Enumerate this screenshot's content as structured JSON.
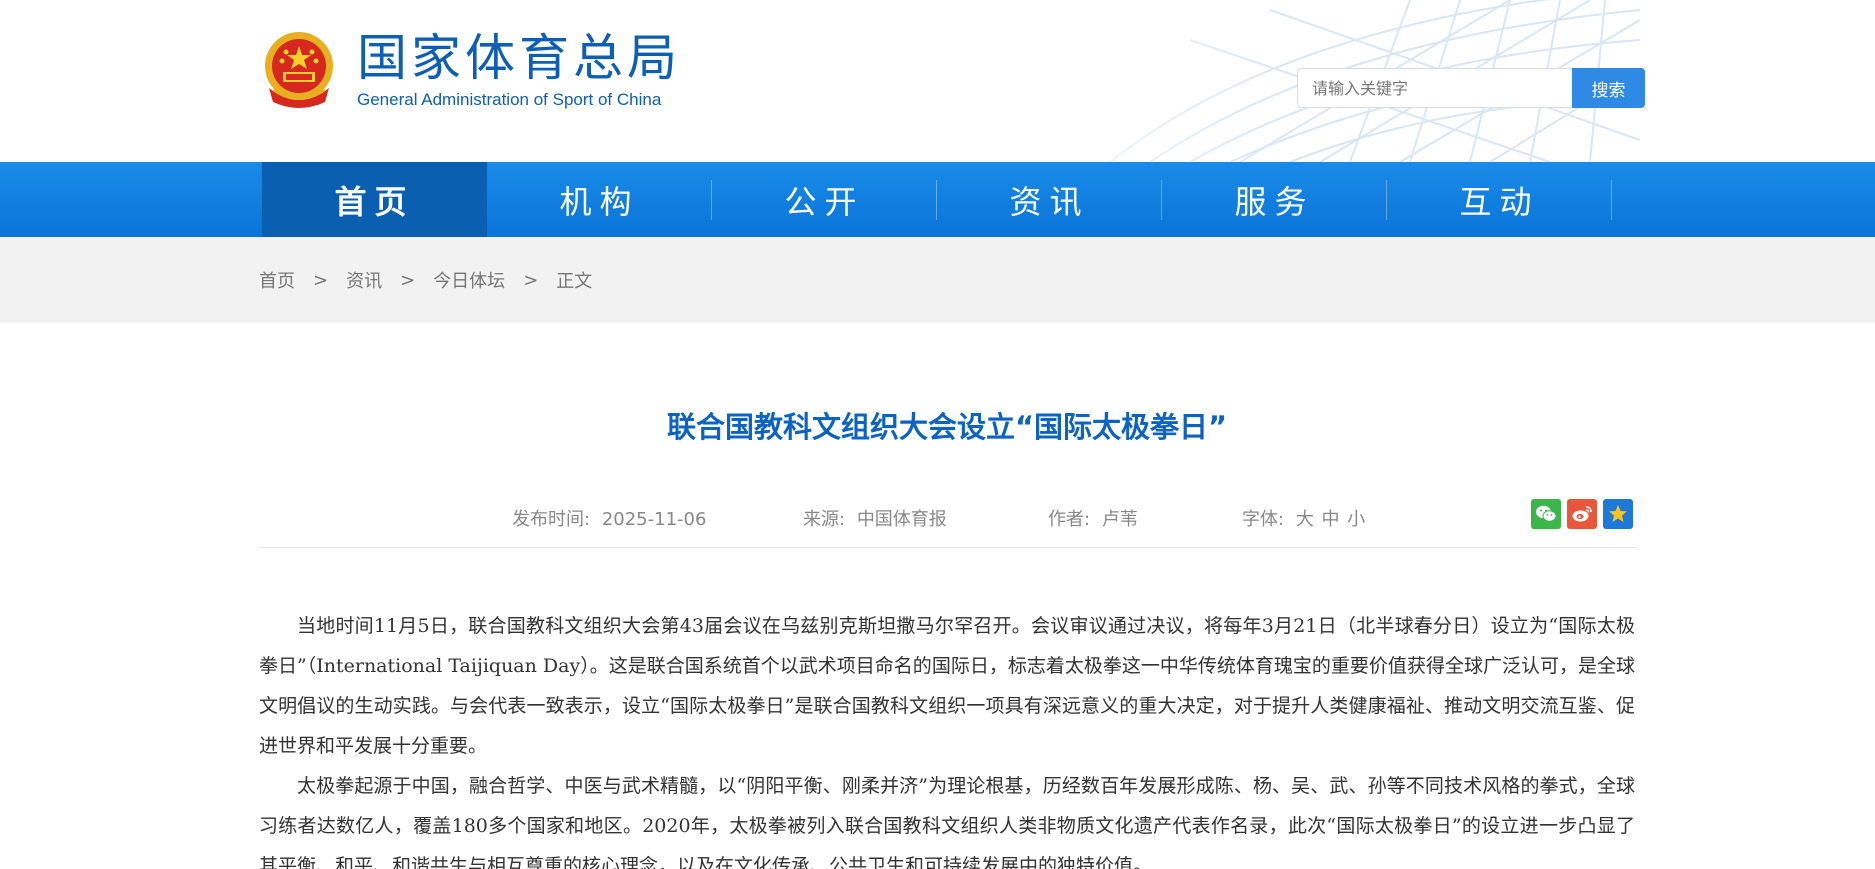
{
  "header": {
    "logo_cn": "国家体育总局",
    "logo_en": "General Administration of Sport of China",
    "search_placeholder": "请输入关键字",
    "search_button": "搜索"
  },
  "nav": {
    "items": [
      {
        "label": "首页",
        "active": true
      },
      {
        "label": "机构",
        "active": false
      },
      {
        "label": "公开",
        "active": false
      },
      {
        "label": "资讯",
        "active": false
      },
      {
        "label": "服务",
        "active": false
      },
      {
        "label": "互动",
        "active": false
      }
    ]
  },
  "breadcrumb": {
    "items": [
      "首页",
      "资讯",
      "今日体坛",
      "正文"
    ],
    "separator": ">"
  },
  "article": {
    "title": "联合国教科文组织大会设立“国际太极拳日”",
    "date_label": "发布时间:",
    "date": "2025-11-06",
    "source_label": "来源:",
    "source": "中国体育报",
    "author_label": "作者:",
    "author": "卢苇",
    "font_label": "字体:",
    "font_sizes": [
      "大",
      "中",
      "小"
    ],
    "share_icons": [
      "wechat-icon",
      "weibo-icon",
      "favorite-icon"
    ],
    "paragraphs": [
      "当地时间11月5日，联合国教科文组织大会第43届会议在乌兹别克斯坦撒马尔罕召开。会议审议通过决议，将每年3月21日（北半球春分日）设立为“国际太极拳日”（International Taijiquan Day）。这是联合国系统首个以武术项目命名的国际日，标志着太极拳这一中华传统体育瑰宝的重要价值获得全球广泛认可，是全球文明倡议的生动实践。与会代表一致表示，设立“国际太极拳日”是联合国教科文组织一项具有深远意义的重大决定，对于提升人类健康福祉、推动文明交流互鉴、促进世界和平发展十分重要。",
      "太极拳起源于中国，融合哲学、中医与武术精髓，以“阴阳平衡、刚柔并济”为理论根基，历经数百年发展形成陈、杨、吴、武、孙等不同技术风格的拳式，全球习练者达数亿人，覆盖180多个国家和地区。2020年，太极拳被列入联合国教科文组织人类非物质文化遗产代表作名录，此次“国际太极拳日”的设立进一步凸显了其平衡、和平、和谐共生与相互尊重的核心理念，以及在文化传承、公共卫生和可持续发展中的独特价值。"
    ]
  },
  "colors": {
    "brand_blue": "#0d5eb5",
    "nav_blue": "#0a74d8",
    "nav_active": "#0a5fb0",
    "title_blue": "#0d63c2"
  }
}
